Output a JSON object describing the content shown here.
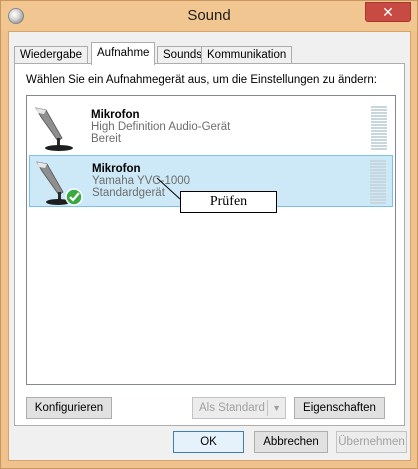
{
  "window": {
    "title": "Sound",
    "close_label": "✕"
  },
  "tabs": [
    {
      "label": "Wiedergabe",
      "active": false
    },
    {
      "label": "Aufnahme",
      "active": true
    },
    {
      "label": "Sounds",
      "active": false
    },
    {
      "label": "Kommunikation",
      "active": false
    }
  ],
  "panel": {
    "instruction": "Wählen Sie ein Aufnahmegerät aus, um die Einstellungen zu ändern:",
    "devices": [
      {
        "name": "Mikrofon",
        "description": "High Definition Audio-Gerät",
        "status": "Bereit",
        "selected": false,
        "default": false
      },
      {
        "name": "Mikrofon",
        "description": "Yamaha YVC-1000",
        "status": "Standardgerät",
        "selected": true,
        "default": true
      }
    ],
    "callout": "Prüfen",
    "buttons": {
      "configure": "Konfigurieren",
      "set_default": "Als Standard",
      "properties": "Eigenschaften"
    }
  },
  "footer": {
    "ok": "OK",
    "cancel": "Abbrechen",
    "apply": "Übernehmen"
  },
  "colors": {
    "frame": "#f2c690",
    "selection": "#cde8f7",
    "close": "#c74b42"
  }
}
